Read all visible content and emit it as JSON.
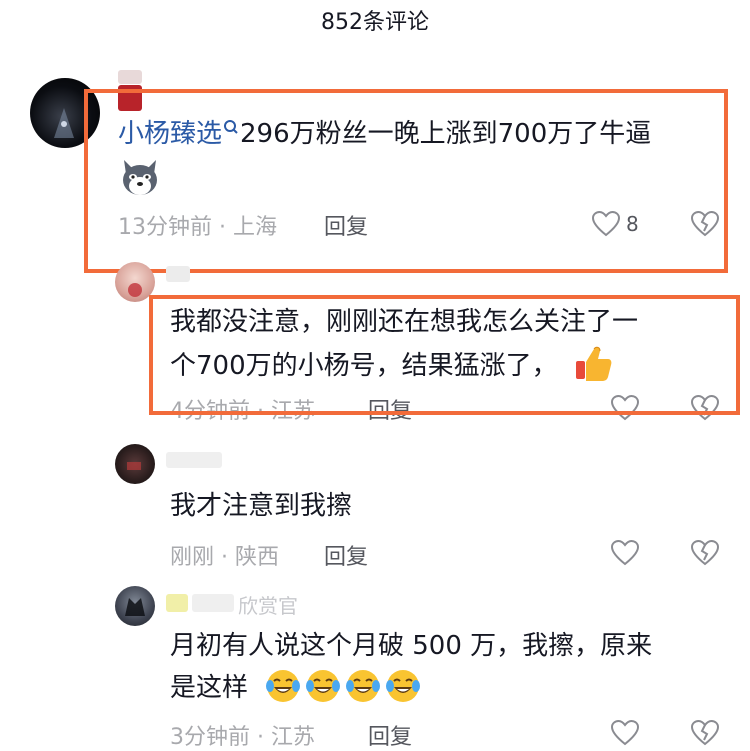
{
  "header": {
    "title": "852条评论"
  },
  "comments": [
    {
      "username": "小杨臻选",
      "text": "296万粉丝一晚上涨到700万了牛逼",
      "time": "13分钟前",
      "sep": "·",
      "location": "上海",
      "reply": "回复",
      "likes": "8"
    },
    {
      "text_line1": "我都没注意，刚刚还在想我怎么关注了一",
      "text_line2": "个700万的小杨号，结果猛涨了，",
      "time": "4分钟前",
      "sep": "·",
      "location": "江苏",
      "reply": "回复"
    },
    {
      "text": "我才注意到我擦",
      "time": "刚刚",
      "sep": "·",
      "location": "陕西",
      "reply": "回复"
    },
    {
      "name_fragment": "欣赏官",
      "text_line1": "月初有人说这个月破 500 万，我擦，原来",
      "text_line2": "是这样",
      "time": "3分钟前",
      "sep": "·",
      "location": "江苏",
      "reply": "回复"
    }
  ],
  "colors": {
    "highlight": "#f26b3a",
    "username": "#2b5aa6",
    "meta": "#a8a9ad"
  },
  "icons": [
    "search-icon",
    "wolf-emoji",
    "heart-icon",
    "dislike-icon",
    "thumbs-up-emoji",
    "laughing-crying-emoji"
  ]
}
